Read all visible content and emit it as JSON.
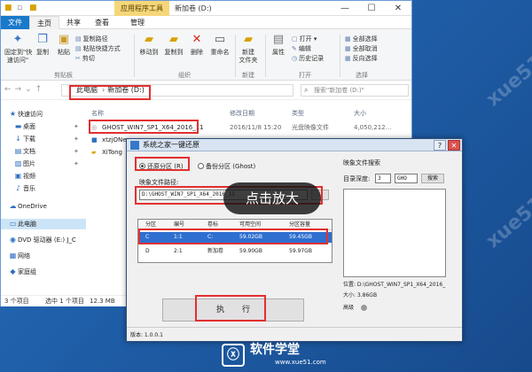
{
  "explorer": {
    "title": "新加卷 (D:)",
    "context_tab": "应用程序工具",
    "menu": {
      "file": "文件",
      "home": "主页",
      "share": "共享",
      "view": "查看",
      "manage": "管理"
    },
    "ribbon": {
      "pin": "固定到\"快\n速访问\"",
      "copy": "复制",
      "paste": "粘贴",
      "copy_path": "复制路径",
      "paste_shortcut": "粘贴快捷方式",
      "cut": "剪切",
      "move_to": "移动到",
      "copy_to": "复制到",
      "delete": "删除",
      "rename": "重命名",
      "new_folder": "新建\n文件夹",
      "properties": "属性",
      "open": "打开",
      "edit": "编辑",
      "history": "历史记录",
      "select_all": "全部选择",
      "select_none": "全部取消",
      "invert": "反向选择",
      "group_clipboard": "剪贴板",
      "group_organize": "组织",
      "group_new": "新建",
      "group_open": "打开",
      "group_select": "选择"
    },
    "address": {
      "crumbs": [
        "此电脑",
        "新加卷 (D:)"
      ],
      "search_placeholder": "搜索\"新加卷 (D:)\""
    },
    "nav": {
      "quick_access": "快速访问",
      "desktop": "桌面",
      "downloads": "下载",
      "documents": "文档",
      "pictures": "图片",
      "videos": "视频",
      "music": "音乐",
      "onedrive": "OneDrive",
      "this_pc": "此电脑",
      "dvd": "DVD 驱动器 (E:) J_C",
      "network": "网络",
      "homegroup": "家庭组"
    },
    "columns": {
      "name": "名称",
      "date": "修改日期",
      "type": "类型",
      "size": "大小"
    },
    "files": [
      {
        "name": "GHOST_WIN7_SP1_X64_2016_11",
        "date": "2016/11/8 15:20",
        "type": "光盘映像文件",
        "size": "4,050,212..."
      },
      {
        "name": "xtzjONe",
        "date": "",
        "type": "",
        "size": ""
      },
      {
        "name": "XiTong",
        "date": "",
        "type": "",
        "size": ""
      }
    ],
    "status": {
      "count": "3 个项目",
      "selected": "选中 1 个项目",
      "size": "12.3 MB"
    }
  },
  "dialog": {
    "title": "系统之家一键还原",
    "restore_label": "还原分区 (R)",
    "backup_label": "备份分区 (Ghost)",
    "path_label": "映象文件路径:",
    "path_value": "D:\\GHOST_WIN7_SP1_X64_2016_11",
    "table": {
      "headers": [
        "分区",
        "编号",
        "卷标",
        "可用空间",
        "分区容量"
      ],
      "rows": [
        [
          "C",
          "1:1",
          "C:",
          "59.02GB",
          "59.45GB"
        ],
        [
          "D",
          "2:1",
          "新加卷",
          "59.90GB",
          "59.97GB"
        ]
      ]
    },
    "execute": "执行",
    "right_title": "映象文件搜索",
    "depth_label": "目录深度:",
    "depth_value": "3",
    "ext_value": "GHO",
    "search_btn": "搜索",
    "info_location": "位置: D:\\GHOST_WIN7_SP1_X64_2016_",
    "info_size": "大小: 3.86GB",
    "info_advanced": "高级",
    "version": "版本: 1.0.0.1"
  },
  "tooltip": "点击放大",
  "logo": {
    "name": "软件学堂",
    "url": "www.xue51.com"
  },
  "watermark": "xue51.com"
}
